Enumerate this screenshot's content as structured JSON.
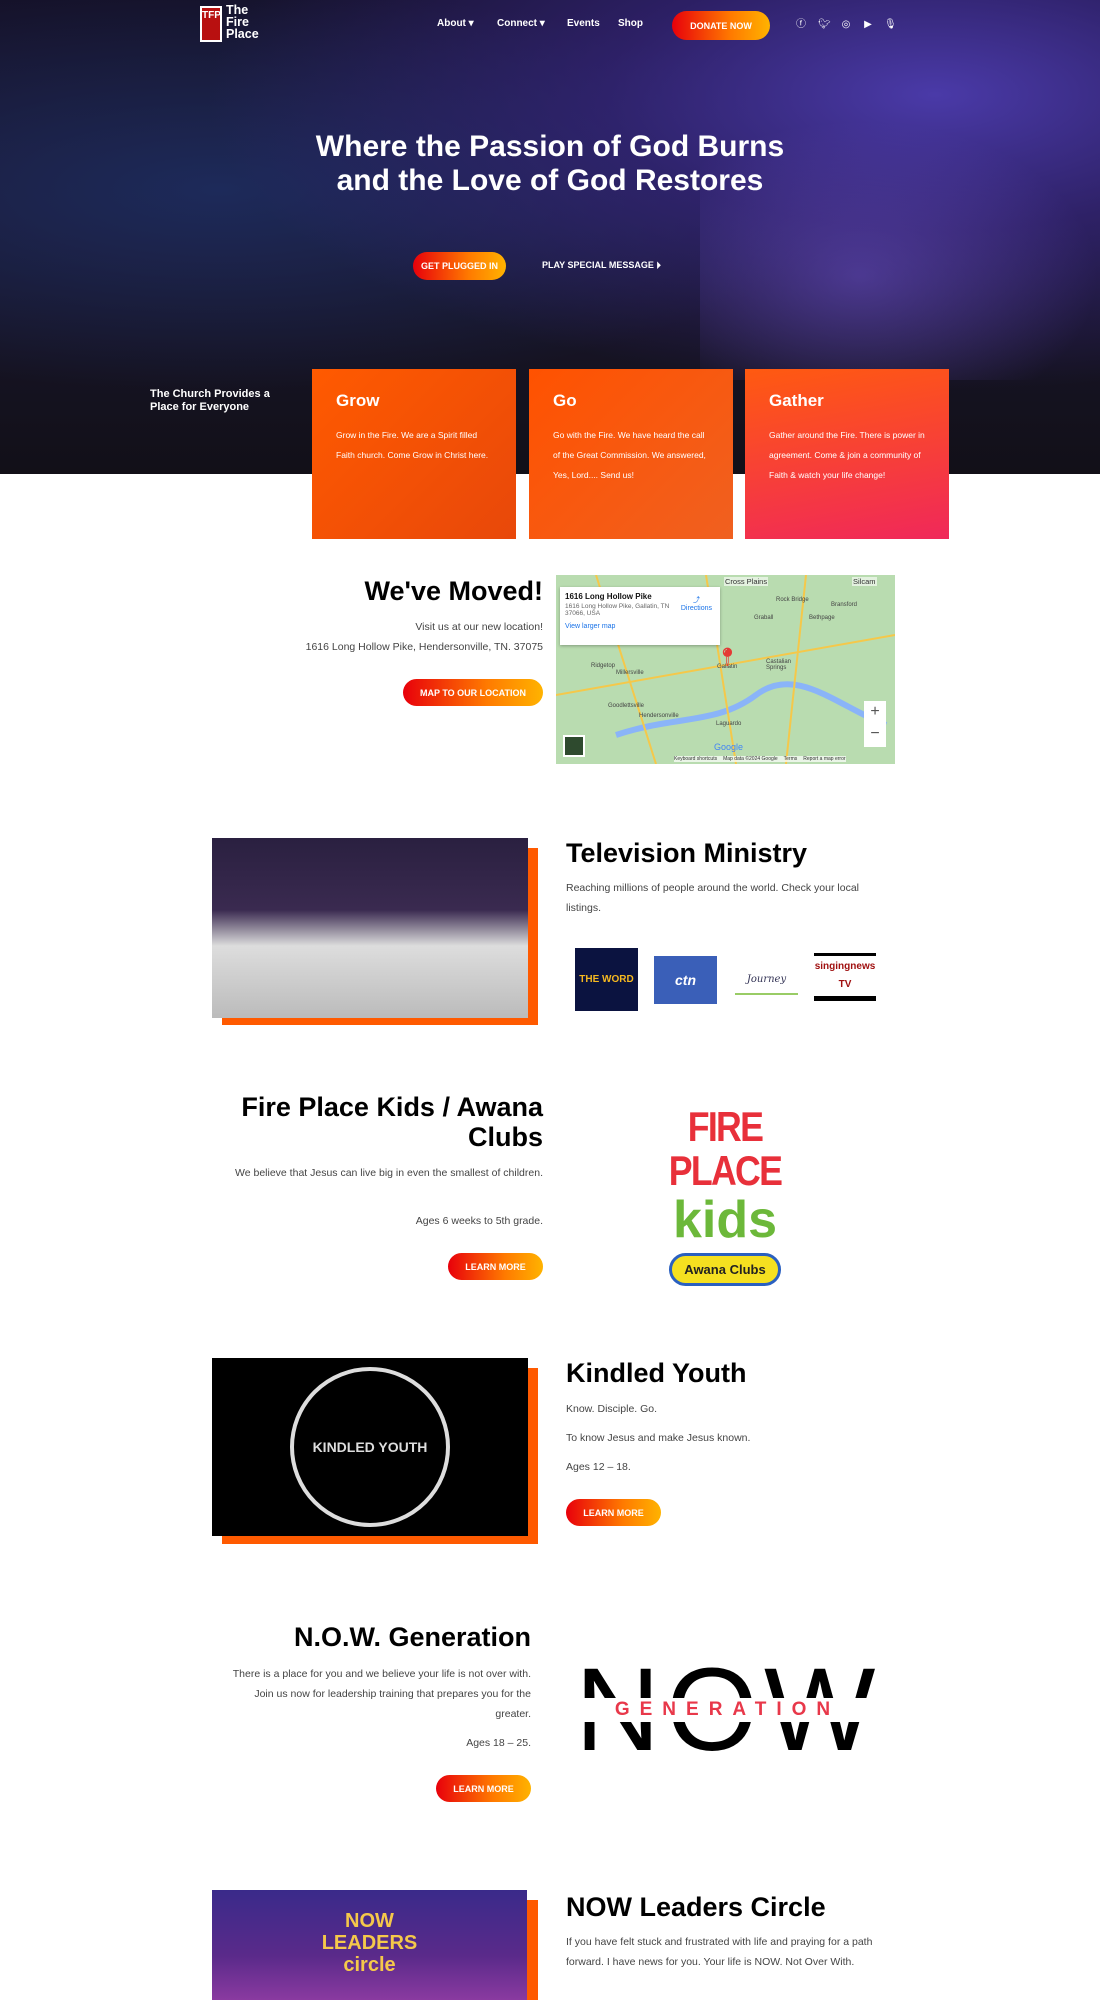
{
  "nav": {
    "logo": "The\nFire\nPlace",
    "logo_mark": "TFP",
    "items": [
      {
        "label": "About",
        "dropdown": true
      },
      {
        "label": "Connect",
        "dropdown": true
      },
      {
        "label": "Events"
      },
      {
        "label": "Shop"
      }
    ],
    "donate": "DONATE NOW",
    "social": [
      "facebook-icon",
      "twitter-icon",
      "instagram-icon",
      "youtube-icon",
      "podcast-icon"
    ]
  },
  "hero": {
    "title_line1": "Where the Passion of God Burns",
    "title_line2": "and the Love of God Restores",
    "primary_button": "GET PLUGGED IN",
    "secondary_button": "PLAY SPECIAL MESSAGE"
  },
  "intro": "The Church Provides a Place for Everyone",
  "cards": [
    {
      "title": "Grow",
      "text": "Grow in the Fire. We are a Spirit filled Faith church. Come Grow in Christ here."
    },
    {
      "title": "Go",
      "text": "Go with the Fire. We have heard the call of the Great Commission. We answered, Yes, Lord.... Send us!"
    },
    {
      "title": "Gather",
      "text": "Gather around the Fire. There is power in agreement. Come & join a community of Faith & watch your life change!"
    }
  ],
  "moved": {
    "title": "We've Moved!",
    "line1": "Visit us at our new location!",
    "line2": "1616 Long Hollow Pike, Hendersonville, TN. 37075",
    "button": "MAP TO OUR LOCATION",
    "map": {
      "place": "1616 Long Hollow Pike",
      "address": "1616 Long Hollow Pike, Gallatin, TN 37066, USA",
      "directions": "Directions",
      "larger": "View larger map",
      "towns": [
        "Cross Plains",
        "Rock Bridge",
        "Bransford",
        "Graball",
        "Bethpage",
        "Ridgetop",
        "Millersville",
        "Gallatin",
        "Castalian Springs",
        "Goodlettsville",
        "Hendersonville",
        "Laguardo",
        "Silcam"
      ],
      "footer": [
        "Keyboard shortcuts",
        "Map data ©2024 Google",
        "Terms",
        "Report a map error"
      ],
      "google": "Google"
    }
  },
  "tv": {
    "title": "Television Ministry",
    "text": "Reaching millions of people around the world. Check your local listings.",
    "logos": [
      "THE WORD",
      "ctn",
      "Journey",
      "singingnews TV"
    ]
  },
  "kids": {
    "title": "Fire Place Kids / Awana Clubs",
    "text": "We believe that Jesus can live big in even the smallest of children.",
    "ages": "Ages 6 weeks to 5th grade.",
    "button": "LEARN MORE",
    "logo_line1": "FIRE PLACE",
    "logo_line2": "kids",
    "awana": "Awana Clubs"
  },
  "youth": {
    "title": "Kindled Youth",
    "line1": "Know. Disciple. Go.",
    "line2": "To know Jesus and make Jesus known.",
    "ages": "Ages 12 – 18.",
    "button": "LEARN MORE",
    "logo": "KINDLED YOUTH"
  },
  "now": {
    "title": "N.O.W. Generation",
    "text": "There is a place for you and we believe your life is not over with. Join us now for leadership training that prepares you for the greater.",
    "ages": "Ages 18 – 25.",
    "button": "LEARN MORE",
    "logo_big": "NOW",
    "logo_sub": "GENERATION"
  },
  "leaders": {
    "title": "NOW Leaders Circle",
    "text": "If you have felt stuck and frustrated with life and praying for a path forward. I have news for you. Your life is NOW. Not Over With.",
    "logo": "NOW LEADERS circle"
  }
}
